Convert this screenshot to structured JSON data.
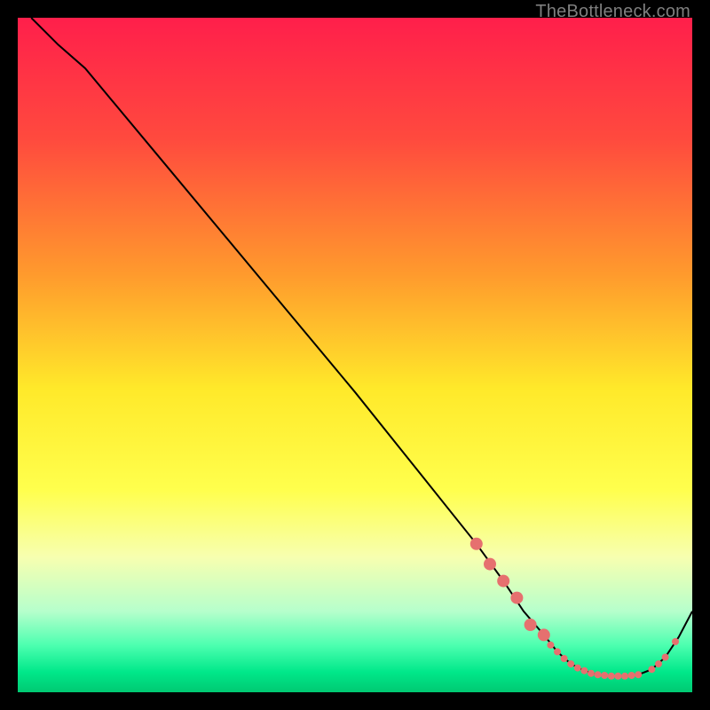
{
  "watermark": "TheBottleneck.com",
  "chart_data": {
    "type": "line",
    "title": "",
    "xlabel": "",
    "ylabel": "",
    "xlim": [
      0,
      100
    ],
    "ylim": [
      0,
      100
    ],
    "background_gradient": {
      "stops": [
        {
          "offset": 0,
          "color": "#ff1f4b"
        },
        {
          "offset": 18,
          "color": "#ff4a3e"
        },
        {
          "offset": 38,
          "color": "#ff9a2d"
        },
        {
          "offset": 55,
          "color": "#ffe92a"
        },
        {
          "offset": 70,
          "color": "#ffff4d"
        },
        {
          "offset": 80,
          "color": "#f7ffb0"
        },
        {
          "offset": 88,
          "color": "#b6ffcc"
        },
        {
          "offset": 93,
          "color": "#4dffb0"
        },
        {
          "offset": 97,
          "color": "#00e88a"
        },
        {
          "offset": 100,
          "color": "#00c972"
        }
      ]
    },
    "series": [
      {
        "name": "bottleneck-curve",
        "color": "#000000",
        "x": [
          2,
          6,
          10,
          20,
          30,
          40,
          50,
          60,
          68,
          72,
          75,
          78,
          80,
          82,
          84,
          86,
          88,
          90,
          92,
          94,
          96,
          98,
          100
        ],
        "y": [
          100,
          96,
          92.5,
          80.5,
          68.5,
          56.5,
          44.5,
          32,
          22,
          16.5,
          12,
          8.5,
          6,
          4.2,
          3.2,
          2.6,
          2.4,
          2.4,
          2.6,
          3.4,
          5.2,
          8.2,
          12
        ]
      }
    ],
    "markers": {
      "name": "highlight-dots",
      "color": "#e6706f",
      "radius_small": 4,
      "radius_large": 7,
      "points": [
        {
          "x": 68,
          "y": 22,
          "r": "large"
        },
        {
          "x": 70,
          "y": 19,
          "r": "large"
        },
        {
          "x": 72,
          "y": 16.5,
          "r": "large"
        },
        {
          "x": 74,
          "y": 14,
          "r": "large"
        },
        {
          "x": 76,
          "y": 10,
          "r": "large"
        },
        {
          "x": 78,
          "y": 8.5,
          "r": "large"
        },
        {
          "x": 79,
          "y": 7,
          "r": "small"
        },
        {
          "x": 80,
          "y": 6,
          "r": "small"
        },
        {
          "x": 81,
          "y": 5,
          "r": "small"
        },
        {
          "x": 82,
          "y": 4.2,
          "r": "small"
        },
        {
          "x": 83,
          "y": 3.6,
          "r": "small"
        },
        {
          "x": 84,
          "y": 3.2,
          "r": "small"
        },
        {
          "x": 85,
          "y": 2.8,
          "r": "small"
        },
        {
          "x": 86,
          "y": 2.6,
          "r": "small"
        },
        {
          "x": 87,
          "y": 2.5,
          "r": "small"
        },
        {
          "x": 88,
          "y": 2.4,
          "r": "small"
        },
        {
          "x": 89,
          "y": 2.4,
          "r": "small"
        },
        {
          "x": 90,
          "y": 2.4,
          "r": "small"
        },
        {
          "x": 91,
          "y": 2.5,
          "r": "small"
        },
        {
          "x": 92,
          "y": 2.6,
          "r": "small"
        },
        {
          "x": 94,
          "y": 3.4,
          "r": "small"
        },
        {
          "x": 95,
          "y": 4.2,
          "r": "small"
        },
        {
          "x": 96,
          "y": 5.2,
          "r": "small"
        },
        {
          "x": 97.5,
          "y": 7.5,
          "r": "small"
        }
      ]
    }
  }
}
